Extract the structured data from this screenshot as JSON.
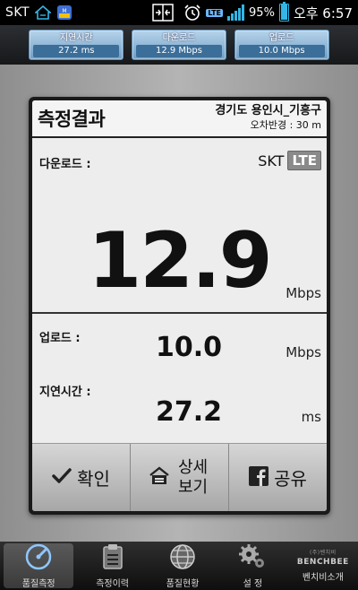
{
  "status_bar": {
    "carrier": "SKT",
    "network_badge": "LTE",
    "battery": "95%",
    "battery_level": 0.95,
    "clock": "오후 6:57",
    "icons": [
      "home-icon",
      "app-notification-icon",
      "data-transfer-icon",
      "alarm-clock-icon",
      "signal-strength-icon",
      "battery-icon"
    ]
  },
  "summary": {
    "latency": {
      "label": "지연시간",
      "value": "27.2 ms"
    },
    "download": {
      "label": "다운로드",
      "value": "12.9 Mbps"
    },
    "upload": {
      "label": "업로드",
      "value": "10.0 Mbps"
    }
  },
  "result": {
    "title": "측정결과",
    "location": "경기도 용인시_기흥구",
    "error_radius": "오차반경 : 30 m",
    "download_label": "다운로드 :",
    "carrier": "SKT",
    "network": "LTE",
    "download_value": "12.9",
    "download_unit": "Mbps",
    "upload_label": "업로드 :",
    "upload_value": "10.0",
    "upload_unit": "Mbps",
    "latency_label": "지연시간 :",
    "latency_value": "27.2",
    "latency_unit": "ms"
  },
  "actions": {
    "confirm": "확인",
    "detail_line1": "상세",
    "detail_line2": "보기",
    "share": "공유"
  },
  "tabs": [
    {
      "label": "품질측정",
      "icon": "speedometer-icon",
      "active": true
    },
    {
      "label": "측정이력",
      "icon": "clipboard-icon",
      "active": false
    },
    {
      "label": "품질현황",
      "icon": "globe-icon",
      "active": false
    },
    {
      "label": "설 정",
      "icon": "gears-icon",
      "active": false
    },
    {
      "label": "벤치비소개",
      "icon": "benchbee-logo",
      "active": false
    }
  ],
  "logo": {
    "small": "(주)벤치비",
    "name": "BENCHBEE"
  },
  "colors": {
    "accent": "#33b5e5",
    "summary_box": "#6f9fc6",
    "lte_badge": "#8a8a8a"
  }
}
